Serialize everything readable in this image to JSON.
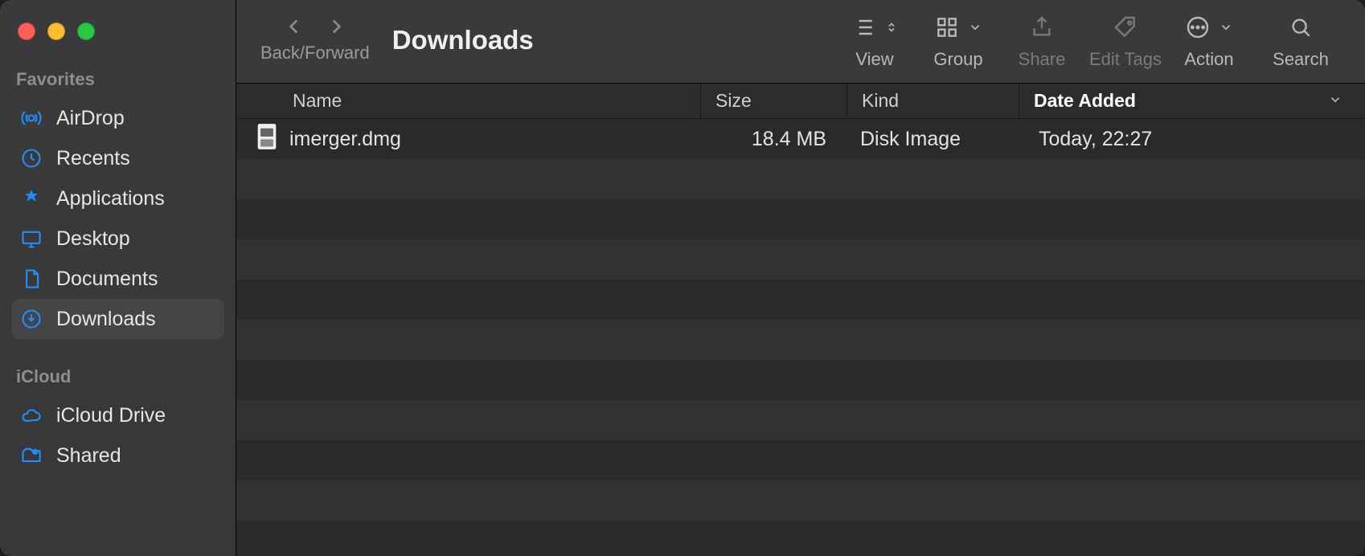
{
  "window": {
    "title": "Downloads"
  },
  "toolbar": {
    "back_forward_label": "Back/Forward",
    "view_label": "View",
    "group_label": "Group",
    "share_label": "Share",
    "edit_tags_label": "Edit Tags",
    "action_label": "Action",
    "search_label": "Search"
  },
  "sidebar": {
    "sections": [
      {
        "label": "Favorites",
        "items": [
          {
            "icon": "airdrop-icon",
            "label": "AirDrop",
            "active": false
          },
          {
            "icon": "clock-icon",
            "label": "Recents",
            "active": false
          },
          {
            "icon": "apps-icon",
            "label": "Applications",
            "active": false
          },
          {
            "icon": "desktop-icon",
            "label": "Desktop",
            "active": false
          },
          {
            "icon": "document-icon",
            "label": "Documents",
            "active": false
          },
          {
            "icon": "download-icon",
            "label": "Downloads",
            "active": true
          }
        ]
      },
      {
        "label": "iCloud",
        "items": [
          {
            "icon": "cloud-icon",
            "label": "iCloud Drive",
            "active": false
          },
          {
            "icon": "shared-icon",
            "label": "Shared",
            "active": false
          }
        ]
      }
    ]
  },
  "columns": {
    "name": "Name",
    "size": "Size",
    "kind": "Kind",
    "date": "Date Added"
  },
  "files": [
    {
      "name": "imerger.dmg",
      "size": "18.4 MB",
      "kind": "Disk Image",
      "date": "Today, 22:27"
    }
  ]
}
